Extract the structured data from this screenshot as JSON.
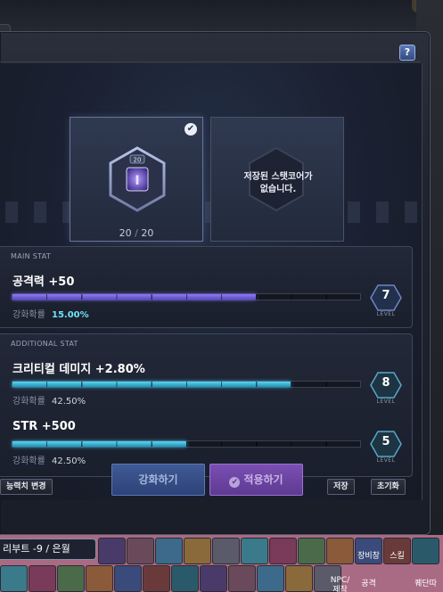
{
  "window": {
    "help_label": "?"
  },
  "cores": {
    "current": "20",
    "separator": "/",
    "max": "20",
    "icon_level": "20",
    "empty_slot_message_line1": "저장된 스탯코어가",
    "empty_slot_message_line2": "없습니다."
  },
  "main_stat": {
    "title": "MAIN STAT",
    "name": "공격력 +50",
    "rate_label": "강화확률",
    "rate_value": "15.00%",
    "progress": 0.7,
    "level": "7",
    "level_label": "LEVEL"
  },
  "additional_stat": {
    "title": "ADDITIONAL STAT",
    "stats": [
      {
        "name": "크리티컬 데미지 +2.80%",
        "rate_label": "강화확률",
        "rate_value": "42.50%",
        "progress": 0.8,
        "level": "8",
        "level_label": "LEVEL"
      },
      {
        "name": "STR +500",
        "rate_label": "강화확률",
        "rate_value": "42.50%",
        "progress": 0.5,
        "level": "5",
        "level_label": "LEVEL"
      }
    ]
  },
  "buttons": {
    "change_stat": "능력치 변경",
    "enhance": "강화하기",
    "apply": "적용하기",
    "save": "저장",
    "reset": "초기화"
  },
  "quickbar": {
    "chat_text": "리부트 -9 / 은월",
    "labels": [
      "장비창",
      "스킬",
      "NPC/\n제작",
      "공격",
      "퀘단따"
    ]
  },
  "colors": {
    "main_bar": "#7d6cf0",
    "additional_bar": "#3fb7db",
    "enhance_button": "#3f5a96",
    "apply_button": "#7a4fb2"
  }
}
